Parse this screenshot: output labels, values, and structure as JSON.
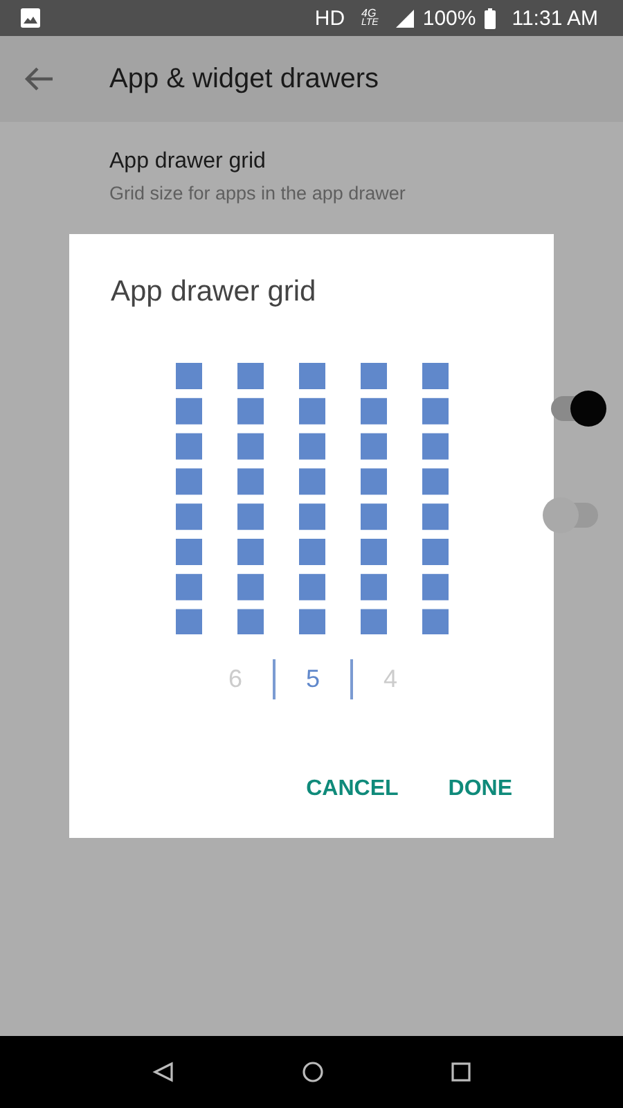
{
  "status_bar": {
    "network": "HD",
    "network_type": "4G",
    "network_sub": "LTE",
    "battery": "100%",
    "time": "11:31 AM"
  },
  "app_bar": {
    "title": "App & widget drawers"
  },
  "settings": [
    {
      "title": "App drawer grid",
      "summary": "Grid size for apps in the app drawer"
    }
  ],
  "background_switches": [
    {
      "on": true
    },
    {
      "on": false
    }
  ],
  "dialog": {
    "title": "App drawer grid",
    "options": [
      {
        "label": "6",
        "selected": false
      },
      {
        "label": "5",
        "selected": true
      },
      {
        "label": "4",
        "selected": false
      }
    ],
    "buttons": [
      "CANCEL",
      "DONE"
    ]
  }
}
